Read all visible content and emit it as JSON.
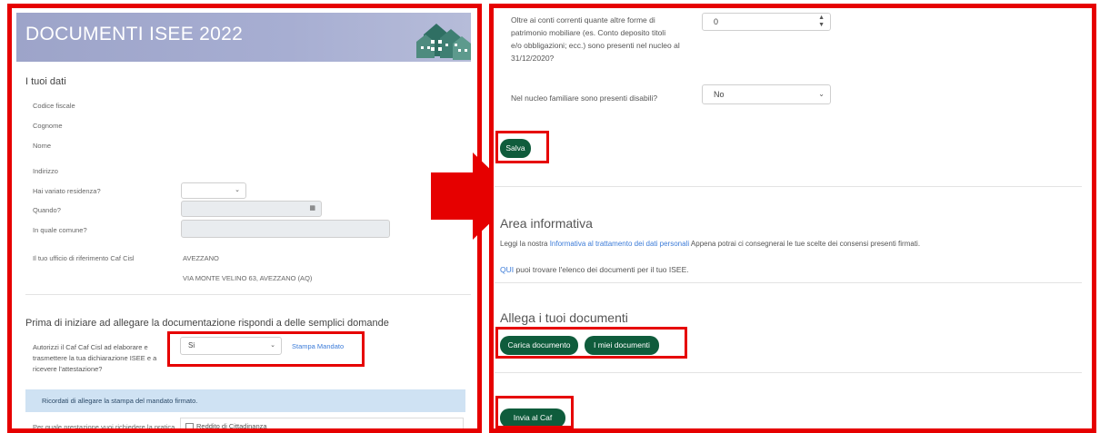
{
  "left": {
    "header_title": "DOCUMENTI ISEE 2022",
    "section_title": "I tuoi dati",
    "fields": {
      "codice_fiscale": "Codice fiscale",
      "cognome": "Cognome",
      "nome": "Nome",
      "indirizzo": "Indirizzo",
      "hai_variato": "Hai variato residenza?",
      "quando": "Quando?",
      "in_quale_comune": "In quale comune?",
      "ufficio_label": "Il tuo ufficio di riferimento Caf Cisl",
      "ufficio_city": "AVEZZANO",
      "ufficio_address": "VIA MONTE VELINO 63, AVEZZANO (AQ)"
    },
    "questions_title": "Prima di iniziare ad allegare la documentazione rispondi a delle semplici domande",
    "autorizzi": {
      "label_l1": "Autorizzi il Caf Caf Cisl ad elaborare e",
      "label_l2": "trasmettere la tua dichiarazione ISEE e a",
      "label_l3": "ricevere l'attestazione?",
      "value": "Si",
      "stampa_link": "Stampa Mandato"
    },
    "alert": "Ricordati di allegare la stampa del mandato firmato.",
    "prestazione": {
      "label": "Per quale prestazione vuoi richiedere la pratica",
      "checkbox_label": "Reddito di Cittadinanza"
    }
  },
  "right": {
    "patrimonio": {
      "label_l1": "Oltre ai conti correnti quante altre forme di",
      "label_l2": "patrimonio mobiliare (es. Conto deposito titoli",
      "label_l3": "e/o obbligazioni; ecc.) sono presenti nel nucleo al",
      "label_l4": "31/12/2020?",
      "value": "0"
    },
    "disabili": {
      "label": "Nel nucleo familiare sono presenti disabili?",
      "value": "No"
    },
    "salva": "Salva",
    "area_title": "Area informativa",
    "area_text": {
      "pre": "Leggi la nostra ",
      "link": "Informativa al trattamento dei dati personali",
      "post": " Appena potrai ci consegnerai le tue scelte dei consensi presenti firmati."
    },
    "qui": {
      "link": "QUI",
      "text": " puoi trovare l'elenco dei documenti per il tuo ISEE."
    },
    "allega_title": "Allega i tuoi documenti",
    "carica": "Carica documento",
    "miei": "I miei documenti",
    "invia": "Invia al Caf"
  },
  "colors": {
    "highlight": "#e60000",
    "button": "#0f5c3c",
    "header": "#a7aed2",
    "link": "#3b7bd8",
    "alert_bg": "#cfe2f3"
  }
}
